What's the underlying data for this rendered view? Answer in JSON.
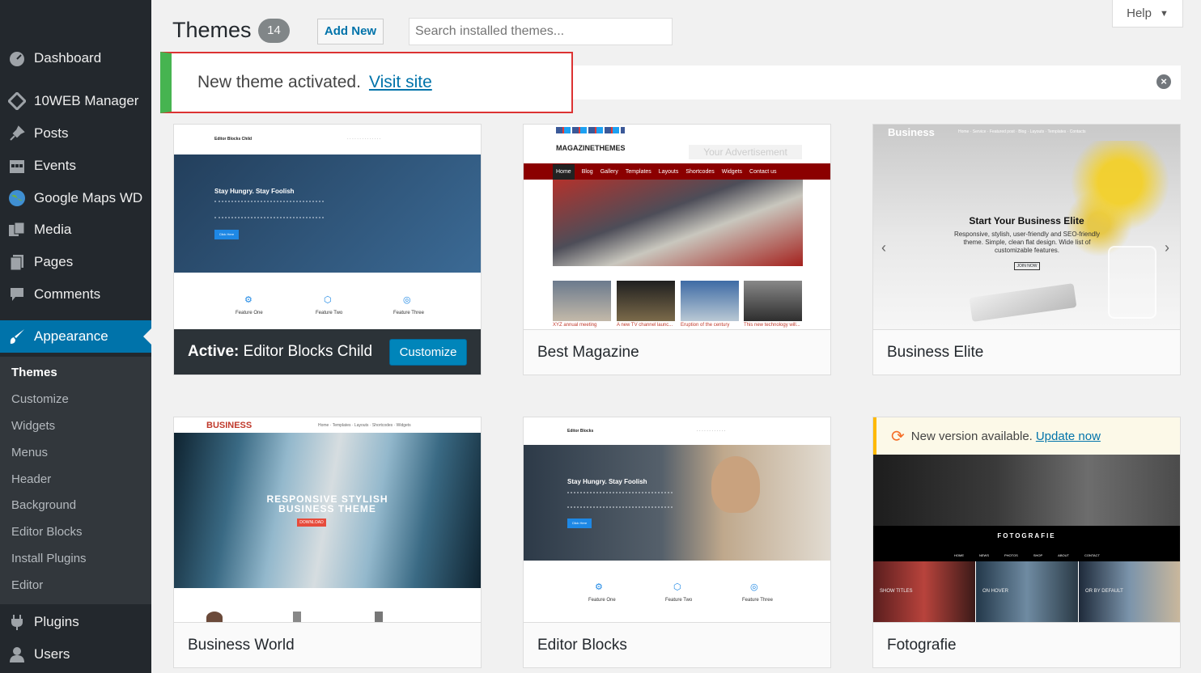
{
  "sidebar": {
    "items": [
      {
        "label": "Dashboard",
        "icon": "dashboard-icon"
      },
      {
        "label": "10WEB Manager",
        "icon": "diamond-icon"
      },
      {
        "label": "Posts",
        "icon": "pin-icon"
      },
      {
        "label": "Events",
        "icon": "calendar-icon"
      },
      {
        "label": "Google Maps WD",
        "icon": "globe-icon"
      },
      {
        "label": "Media",
        "icon": "media-icon"
      },
      {
        "label": "Pages",
        "icon": "page-icon"
      },
      {
        "label": "Comments",
        "icon": "comment-icon"
      },
      {
        "label": "Appearance",
        "icon": "brush-icon"
      },
      {
        "label": "Plugins",
        "icon": "plugin-icon"
      },
      {
        "label": "Users",
        "icon": "user-icon"
      }
    ],
    "submenu": [
      "Themes",
      "Customize",
      "Widgets",
      "Menus",
      "Header",
      "Background",
      "Editor Blocks",
      "Install Plugins",
      "Editor"
    ]
  },
  "header": {
    "title": "Themes",
    "count": "14",
    "add_new": "Add New",
    "search_placeholder": "Search installed themes...",
    "help": "Help"
  },
  "notice": {
    "text": "New theme activated.",
    "link": "Visit site"
  },
  "themes": {
    "active": {
      "prefix": "Active:",
      "name": "Editor Blocks Child",
      "customize": "Customize"
    },
    "t2": {
      "name": "Best Magazine"
    },
    "t3": {
      "name": "Business Elite"
    },
    "t4": {
      "name": "Business World"
    },
    "t5": {
      "name": "Editor Blocks"
    },
    "t6": {
      "name": "Fotografie",
      "update_text": "New version available.",
      "update_link": "Update now"
    }
  },
  "previews": {
    "ebc": {
      "brand": "Editor Blocks Child",
      "hero": "Stay Hungry. Stay Foolish",
      "btn": "Click Here",
      "f1": "Feature One",
      "f2": "Feature Two",
      "f3": "Feature Three"
    },
    "bm": {
      "brand": "MAGAZINETHEMES",
      "ad": "Your Advertisement",
      "nav": [
        "Home",
        "Blog",
        "Gallery",
        "Templates",
        "Layouts",
        "Shortcodes",
        "Widgets",
        "Contact us"
      ],
      "caps": [
        "XYZ annual meeting",
        "A new TV channel launc...",
        "Eruption of the century",
        "This new technology will..."
      ]
    },
    "be": {
      "brand": "Business",
      "hero": "Start Your Business Elite",
      "desc": "Responsive, stylish, user-friendly and SEO-friendly theme. Simple, clean flat design. Wide list of customizable features.",
      "btn": "JOIN NOW"
    },
    "bw": {
      "brand": "BUSINESS",
      "hero1": "RESPONSIVE STYLISH",
      "hero2": "BUSINESS THEME",
      "btn": "DOWNLOAD"
    },
    "eb": {
      "brand": "Editor Blocks",
      "hero": "Stay Hungry. Stay Foolish",
      "btn": "Click Here",
      "f1": "Feature One",
      "f2": "Feature Two",
      "f3": "Feature Three"
    },
    "fo": {
      "brand": "FOTOGRAFIE",
      "nav": [
        "HOME",
        "NEWS",
        "PHOTOS",
        "SHOP",
        "ABOUT",
        "CONTACT"
      ],
      "caps": [
        "SHOW TITLES",
        "ON HOVER",
        "OR BY DEFAULT"
      ]
    }
  }
}
